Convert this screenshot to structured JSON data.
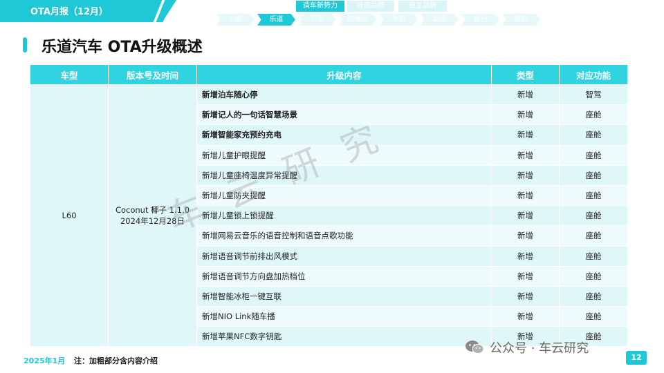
{
  "header": {
    "banner_title": "OTA月报（12月）",
    "categories": [
      {
        "label": "造车新势力",
        "active": true
      },
      {
        "label": "外资品牌",
        "active": false
      },
      {
        "label": "自主品牌",
        "active": false
      }
    ],
    "brands": [
      {
        "label": "小鹏",
        "active": false
      },
      {
        "label": "乐道",
        "active": true
      },
      {
        "label": "小米",
        "active": false
      },
      {
        "label": "阿维塔",
        "active": false
      },
      {
        "label": "零跑",
        "active": false
      },
      {
        "label": "岚图",
        "active": false
      },
      {
        "label": "智己",
        "active": false
      },
      {
        "label": "极石",
        "active": false
      }
    ]
  },
  "page_title": "乐道汽车 OTA升级概述",
  "table": {
    "columns": [
      "车型",
      "版本号及时间",
      "升级内容",
      "类型",
      "对应功能"
    ],
    "model": "L60",
    "version_line1": "Coconut 椰子 1.1.0",
    "version_line2": "2024年12月28日",
    "rows": [
      {
        "content": "新增泊车随心停",
        "type": "新增",
        "function": "智驾",
        "bold": true
      },
      {
        "content": "新增记人的一句话智慧场景",
        "type": "新增",
        "function": "座舱",
        "bold": true
      },
      {
        "content": "新增智能家充预约充电",
        "type": "新增",
        "function": "座舱",
        "bold": true
      },
      {
        "content": "新增儿童护眼提醒",
        "type": "新增",
        "function": "座舱",
        "bold": false
      },
      {
        "content": "新增儿童座椅温度异常提醒",
        "type": "新增",
        "function": "座舱",
        "bold": false
      },
      {
        "content": "新增儿童防夹提醒",
        "type": "新增",
        "function": "座舱",
        "bold": false
      },
      {
        "content": "新增儿童锁上锁提醒",
        "type": "新增",
        "function": "座舱",
        "bold": false
      },
      {
        "content": "新增网易云音乐的语音控制和语音点歌功能",
        "type": "新增",
        "function": "座舱",
        "bold": false
      },
      {
        "content": "新增语音调节前排出风模式",
        "type": "新增",
        "function": "座舱",
        "bold": false
      },
      {
        "content": "新增语音调节方向盘加热档位",
        "type": "新增",
        "function": "座舱",
        "bold": false
      },
      {
        "content": "新增智能冰柜一键互联",
        "type": "新增",
        "function": "座舱",
        "bold": false
      },
      {
        "content": "新增NIO Link随车播",
        "type": "新增",
        "function": "座舱",
        "bold": false
      },
      {
        "content": "新增苹果NFC数字钥匙",
        "type": "新增",
        "function": "座舱",
        "bold": false
      }
    ]
  },
  "watermark": "车云研究",
  "footer": {
    "date": "2025年1月",
    "note": "注：加粗部分含内容介绍",
    "wechat": "公众号 · 车云研究",
    "page_number": "12"
  },
  "colors": {
    "accent": "#1ec8d6",
    "header": "#2fd4e0",
    "row_light": "#e0f7f9"
  }
}
